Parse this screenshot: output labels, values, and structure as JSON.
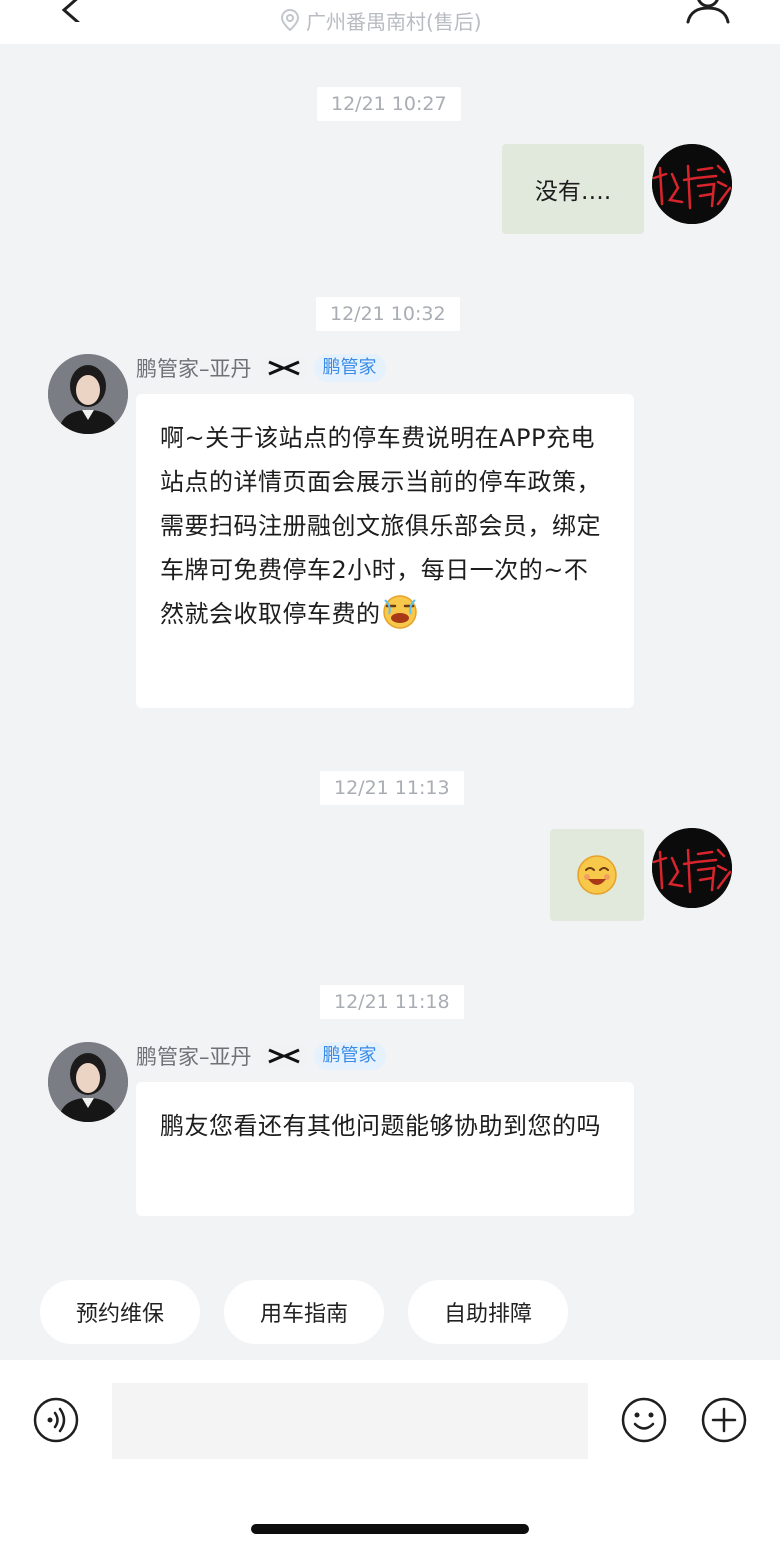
{
  "header": {
    "location": "广州番禺南村(售后)",
    "back_icon": "chevron-left-icon",
    "profile_icon": "user-profile-icon"
  },
  "messages": [
    {
      "timestamp": "12/21 10:27",
      "sender": "user",
      "text": "没有…."
    },
    {
      "timestamp": "12/21 10:32",
      "sender": "agent",
      "agent_name": "鹏管家–亚丹",
      "badge": "鹏管家",
      "text": "啊~关于该站点的停车费说明在APP充电站点的详情页面会展示当前的停车政策，需要扫码注册融创文旅俱乐部会员，绑定车牌可免费停车2小时，每日一次的~不然就会收取停车费的",
      "emoji": "crying-face-icon"
    },
    {
      "timestamp": "12/21 11:13",
      "sender": "user",
      "emoji": "smiling-face-icon"
    },
    {
      "timestamp": "12/21 11:18",
      "sender": "agent",
      "agent_name": "鹏管家–亚丹",
      "badge": "鹏管家",
      "text": "鹏友您看还有其他问题能够协助到您的吗"
    }
  ],
  "quick_replies": [
    "预约维保",
    "用车指南",
    "自助排障"
  ],
  "input": {
    "value": "",
    "placeholder": ""
  },
  "colors": {
    "background": "#f2f3f5",
    "user_bubble": "#e1e8dc",
    "agent_bubble": "#ffffff",
    "badge_text": "#3a8be6",
    "badge_bg": "#e5f1fd"
  }
}
